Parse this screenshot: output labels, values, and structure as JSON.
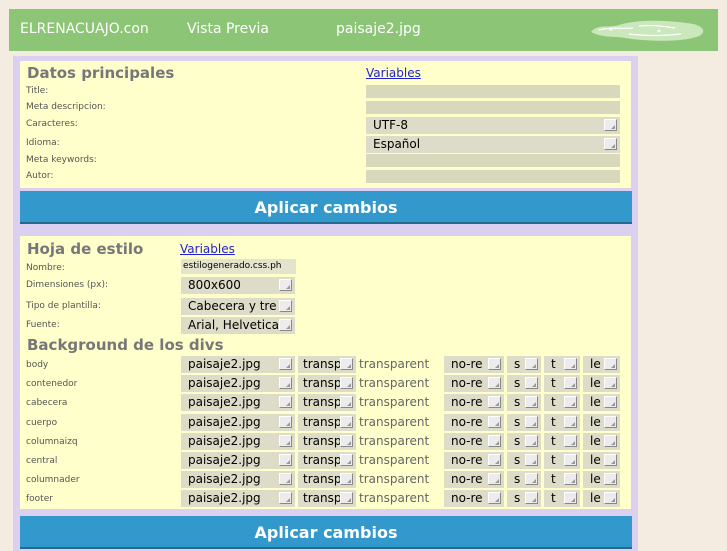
{
  "header": {
    "site_name": "ELRENACUAJO.con",
    "preview_label": "Vista Previa",
    "file_label": "paisaje2.jpg",
    "logo_icon": "tadpole-logo"
  },
  "main_data": {
    "title": "Datos principales",
    "variables_link": "Variables",
    "fields": {
      "title_label": "Title:",
      "meta_desc_label": "Meta descripcion:",
      "charset_label": "Caracteres:",
      "charset_value": "UTF-8",
      "language_label": "Idioma:",
      "language_value": "Español",
      "keywords_label": "Meta keywords:",
      "author_label": "Autor:"
    },
    "apply_label": "Aplicar cambios"
  },
  "stylesheet": {
    "title": "Hoja de estilo",
    "variables_link": "Variables",
    "name_label": "Nombre:",
    "name_value": "estilogenerado.css.ph",
    "dimensions_label": "Dimensiones (px):",
    "dimensions_value": "800x600",
    "template_label": "Tipo de plantilla:",
    "template_value": "Cabecera y tre",
    "font_label": "Fuente:",
    "font_value": "Arial, Helvetica",
    "bg_title": "Background de los divs",
    "bg_rows": [
      {
        "label": "body",
        "image": "paisaje2.jpg",
        "color_sel": "transp",
        "color_text": "transparent",
        "repeat": "no-re",
        "s": "s",
        "t": "t",
        "l": "le"
      },
      {
        "label": "contenedor",
        "image": "paisaje2.jpg",
        "color_sel": "transp",
        "color_text": "transparent",
        "repeat": "no-re",
        "s": "s",
        "t": "t",
        "l": "le"
      },
      {
        "label": "cabecera",
        "image": "paisaje2.jpg",
        "color_sel": "transp",
        "color_text": "transparent",
        "repeat": "no-re",
        "s": "s",
        "t": "t",
        "l": "le"
      },
      {
        "label": "cuerpo",
        "image": "paisaje2.jpg",
        "color_sel": "transp",
        "color_text": "transparent",
        "repeat": "no-re",
        "s": "s",
        "t": "t",
        "l": "le"
      },
      {
        "label": "columnaizq",
        "image": "paisaje2.jpg",
        "color_sel": "transp",
        "color_text": "transparent",
        "repeat": "no-re",
        "s": "s",
        "t": "t",
        "l": "le"
      },
      {
        "label": "central",
        "image": "paisaje2.jpg",
        "color_sel": "transp",
        "color_text": "transparent",
        "repeat": "no-re",
        "s": "s",
        "t": "t",
        "l": "le"
      },
      {
        "label": "columnader",
        "image": "paisaje2.jpg",
        "color_sel": "transp",
        "color_text": "transparent",
        "repeat": "no-re",
        "s": "s",
        "t": "t",
        "l": "le"
      },
      {
        "label": "footer",
        "image": "paisaje2.jpg",
        "color_sel": "transp",
        "color_text": "transparent",
        "repeat": "no-re",
        "s": "s",
        "t": "t",
        "l": "le"
      }
    ],
    "apply_label": "Aplicar cambios"
  },
  "colors": {
    "header_bg": "#8cc576",
    "panel_bg": "#ffffcc",
    "frame_bg": "#dcd0f0",
    "button_bg": "#3399cc",
    "page_bg": "#f4ebe1"
  }
}
